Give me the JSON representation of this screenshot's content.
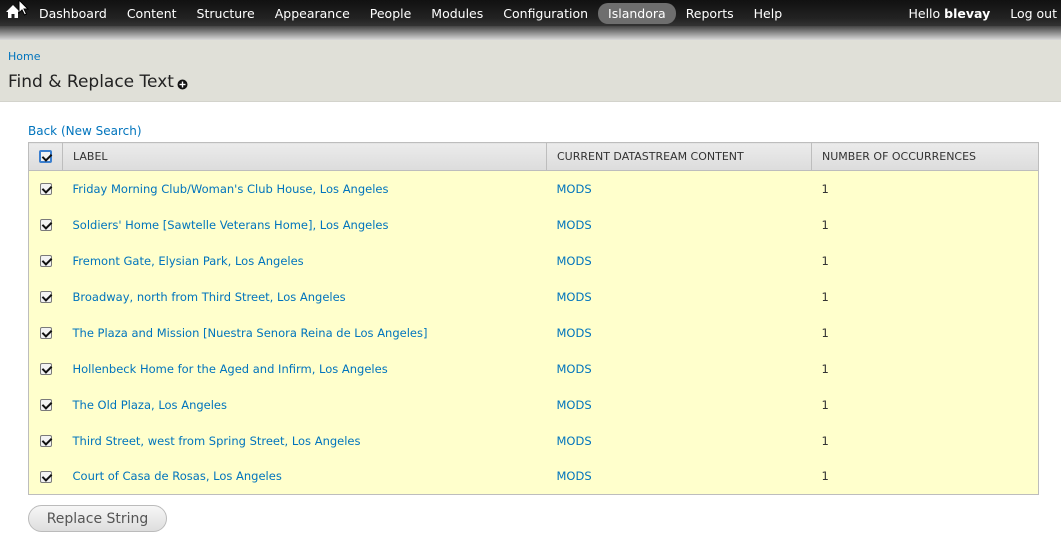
{
  "toolbar": {
    "menu": [
      {
        "label": "Dashboard",
        "active": false
      },
      {
        "label": "Content",
        "active": false
      },
      {
        "label": "Structure",
        "active": false
      },
      {
        "label": "Appearance",
        "active": false
      },
      {
        "label": "People",
        "active": false
      },
      {
        "label": "Modules",
        "active": false
      },
      {
        "label": "Configuration",
        "active": false
      },
      {
        "label": "Islandora",
        "active": true
      },
      {
        "label": "Reports",
        "active": false
      },
      {
        "label": "Help",
        "active": false
      }
    ],
    "hello_prefix": "Hello ",
    "username": "blevay",
    "logout_label": "Log out"
  },
  "header": {
    "breadcrumb": "Home",
    "title": "Find & Replace Text"
  },
  "back_link": "Back (New Search)",
  "table": {
    "columns": [
      "LABEL",
      "CURRENT DATASTREAM CONTENT",
      "NUMBER OF OCCURRENCES"
    ],
    "rows": [
      {
        "label": "Friday Morning Club/Woman's Club House, Los Angeles",
        "datastream": "MODS",
        "occurrences": "1",
        "checked": true
      },
      {
        "label": "Soldiers' Home [Sawtelle Veterans Home], Los Angeles",
        "datastream": "MODS",
        "occurrences": "1",
        "checked": true
      },
      {
        "label": "Fremont Gate, Elysian Park, Los Angeles",
        "datastream": "MODS",
        "occurrences": "1",
        "checked": true
      },
      {
        "label": "Broadway, north from Third Street, Los Angeles",
        "datastream": "MODS",
        "occurrences": "1",
        "checked": true
      },
      {
        "label": "The Plaza and Mission [Nuestra Senora Reina de Los Angeles]",
        "datastream": "MODS",
        "occurrences": "1",
        "checked": true
      },
      {
        "label": "Hollenbeck Home for the Aged and Infirm, Los Angeles",
        "datastream": "MODS",
        "occurrences": "1",
        "checked": true
      },
      {
        "label": "The Old Plaza, Los Angeles",
        "datastream": "MODS",
        "occurrences": "1",
        "checked": true
      },
      {
        "label": "Third Street, west from Spring Street, Los Angeles",
        "datastream": "MODS",
        "occurrences": "1",
        "checked": true
      },
      {
        "label": "Court of Casa de Rosas, Los Angeles",
        "datastream": "MODS",
        "occurrences": "1",
        "checked": true
      }
    ]
  },
  "replace_button": "Replace String",
  "colors": {
    "link": "#0074bd",
    "row_highlight": "#ffffcc",
    "active_menu": "#6e6e6e"
  }
}
